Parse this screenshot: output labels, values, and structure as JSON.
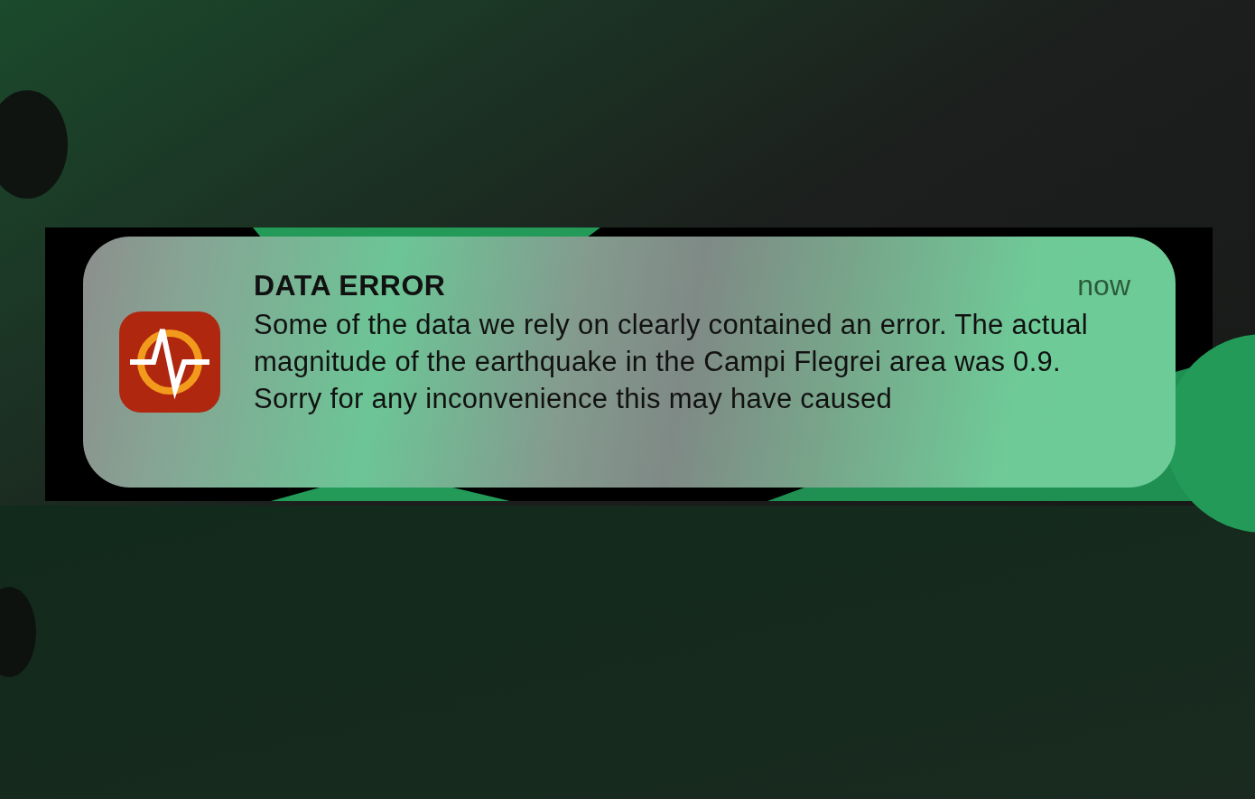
{
  "notification": {
    "title": "DATA ERROR",
    "time": "now",
    "message": "Some of the data we rely on clearly contained an error. The actual magnitude of the earthquake in the Campi Flegrei area was 0.9. Sorry for any inconvenience this may have caused"
  }
}
